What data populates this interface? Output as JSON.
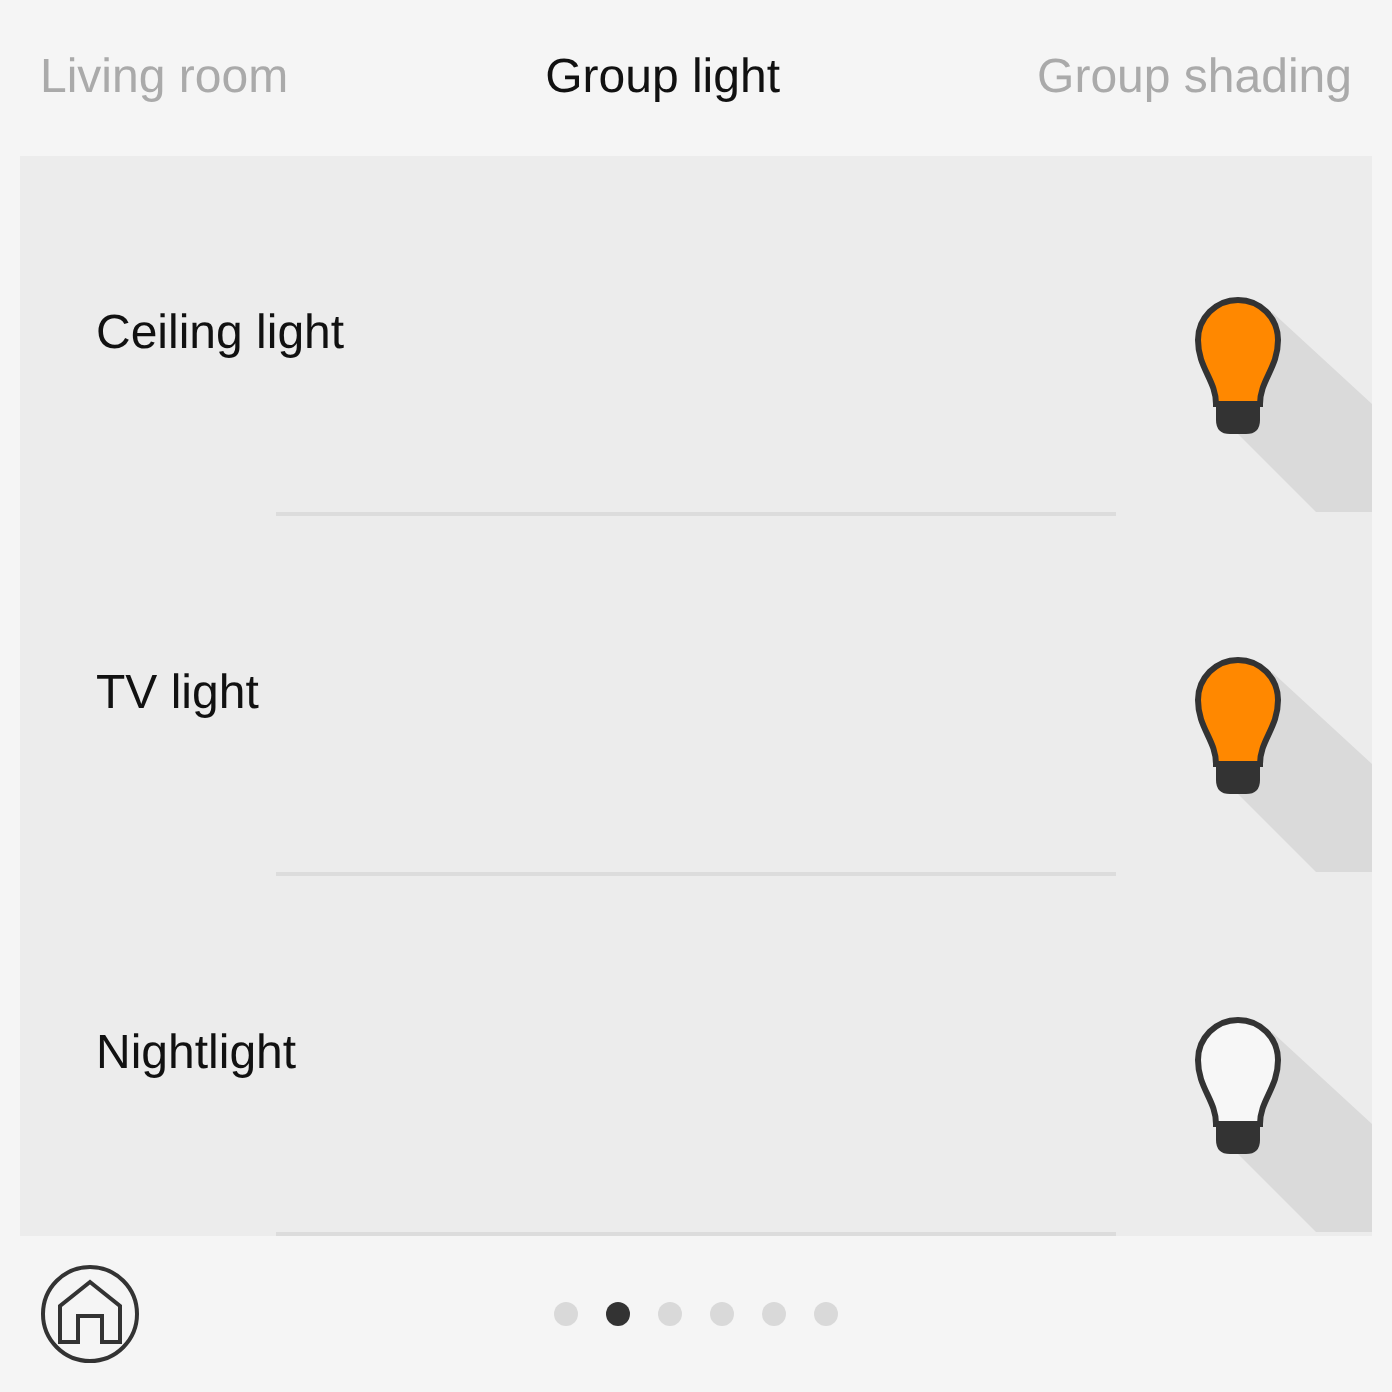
{
  "tabs": [
    {
      "label": "Living room",
      "selected": false
    },
    {
      "label": "Group light",
      "selected": true
    },
    {
      "label": "Group shading",
      "selected": false
    }
  ],
  "lights": [
    {
      "name": "Ceiling light",
      "on": true
    },
    {
      "name": "TV light",
      "on": true
    },
    {
      "name": "Nightlight",
      "on": false
    }
  ],
  "pages": [
    {
      "selected": false
    },
    {
      "selected": true
    },
    {
      "selected": false
    },
    {
      "selected": false
    },
    {
      "selected": false
    },
    {
      "selected": false
    }
  ]
}
